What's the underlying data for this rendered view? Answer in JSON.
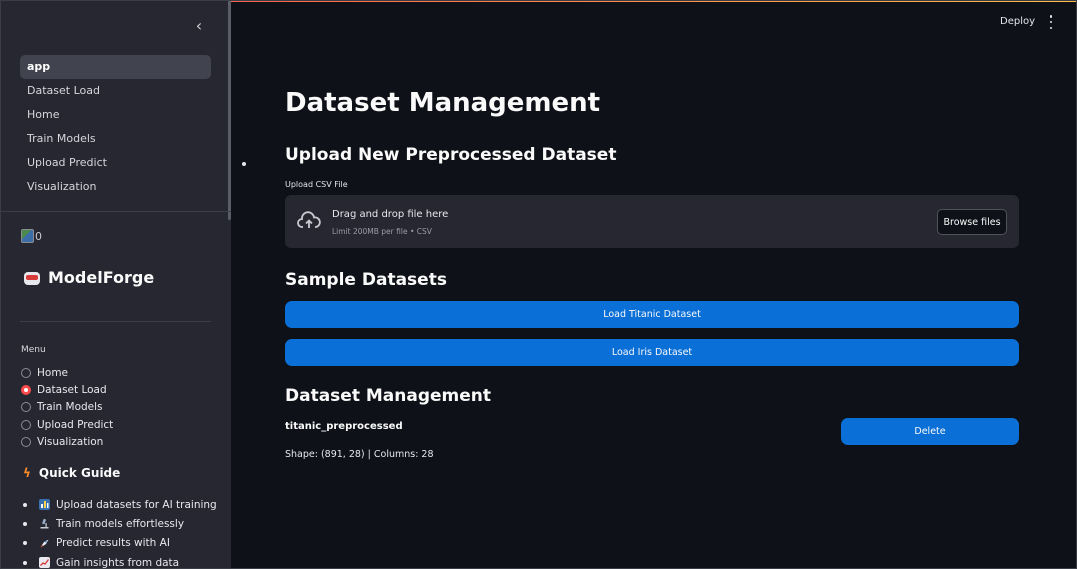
{
  "header": {
    "deploy_label": "Deploy"
  },
  "sidebar": {
    "pages": [
      {
        "label": "app",
        "active": true
      },
      {
        "label": "Dataset Load"
      },
      {
        "label": "Home"
      },
      {
        "label": "Train Models"
      },
      {
        "label": "Upload Predict"
      },
      {
        "label": "Visualization"
      }
    ],
    "image_alt": "0",
    "brand": "ModelForge",
    "menu_label": "Menu",
    "menu_options": [
      "Home",
      "Dataset Load",
      "Train Models",
      "Upload Predict",
      "Visualization"
    ],
    "menu_selected": "Dataset Load",
    "guide_title": "Quick Guide",
    "guide_items": [
      {
        "icon": "bar-chart-icon",
        "text": "Upload datasets for AI training"
      },
      {
        "icon": "microscope-icon",
        "text": "Train models effortlessly"
      },
      {
        "icon": "rocket-icon",
        "text": "Predict results with AI"
      },
      {
        "icon": "trend-chart-icon",
        "text": "Gain insights from data"
      }
    ]
  },
  "main": {
    "title": "Dataset Management",
    "upload_heading": "Upload New Preprocessed Dataset",
    "upload_label": "Upload CSV File",
    "dropzone_title": "Drag and drop file here",
    "dropzone_limit": "Limit 200MB per file • CSV",
    "browse_label": "Browse files",
    "samples_heading": "Sample Datasets",
    "load_titanic": "Load Titanic Dataset",
    "load_iris": "Load Iris Dataset",
    "manage_heading": "Dataset Management",
    "dataset_name": "titanic_preprocessed",
    "dataset_shape": "Shape: (891, 28) | Columns: 28",
    "delete_label": "Delete"
  },
  "colors": {
    "accent_blue": "#0a6fd6",
    "accent_red": "#ff4b4b",
    "sidebar_bg": "#262730",
    "main_bg": "#0e1117"
  }
}
